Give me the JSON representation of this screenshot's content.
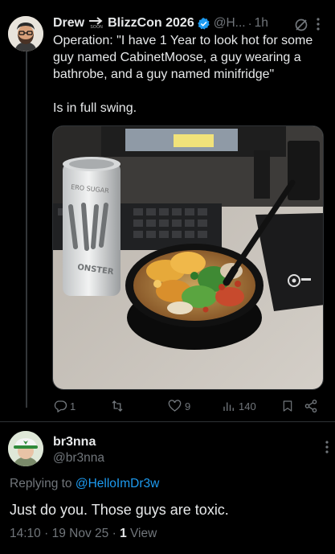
{
  "post": {
    "author_name": "Drew",
    "badge_caption": "SOON",
    "author_name_2": "BlizzCon 2026",
    "handle": "@H...",
    "separator": "·",
    "time": "1h",
    "text_1": "Operation: \"I have 1 Year to look hot for some guy named CabinetMoose, a guy wearing a bathrobe, and a guy named minifridge\"",
    "text_2": "Is in full swing.",
    "media": {
      "description_icons": [
        "energy-drink-can",
        "keyboard",
        "salad-bowl",
        "fork",
        "mousepad"
      ],
      "can_text_top": "ERO SUGAR",
      "can_text_brand": "ONSTER",
      "mousepad_logo": "steelseries"
    },
    "actions": {
      "replies": "1",
      "reposts": "",
      "likes": "9",
      "views": "140"
    }
  },
  "reply": {
    "name": "br3nna",
    "handle": "@br3nna",
    "replying_prefix": "Replying to ",
    "replying_handle": "@HelloImDr3w",
    "text": "Just do you. Those guys are toxic.",
    "time": "14:10",
    "date": "19 Nov 25",
    "views_count": "1",
    "views_label": "View",
    "separator": "·"
  },
  "colors": {
    "background": "#000000",
    "text": "#e7e9ea",
    "muted": "#71767b",
    "link": "#1d9bf0",
    "verified": "#1d9bf0",
    "divider": "#2f3336"
  }
}
